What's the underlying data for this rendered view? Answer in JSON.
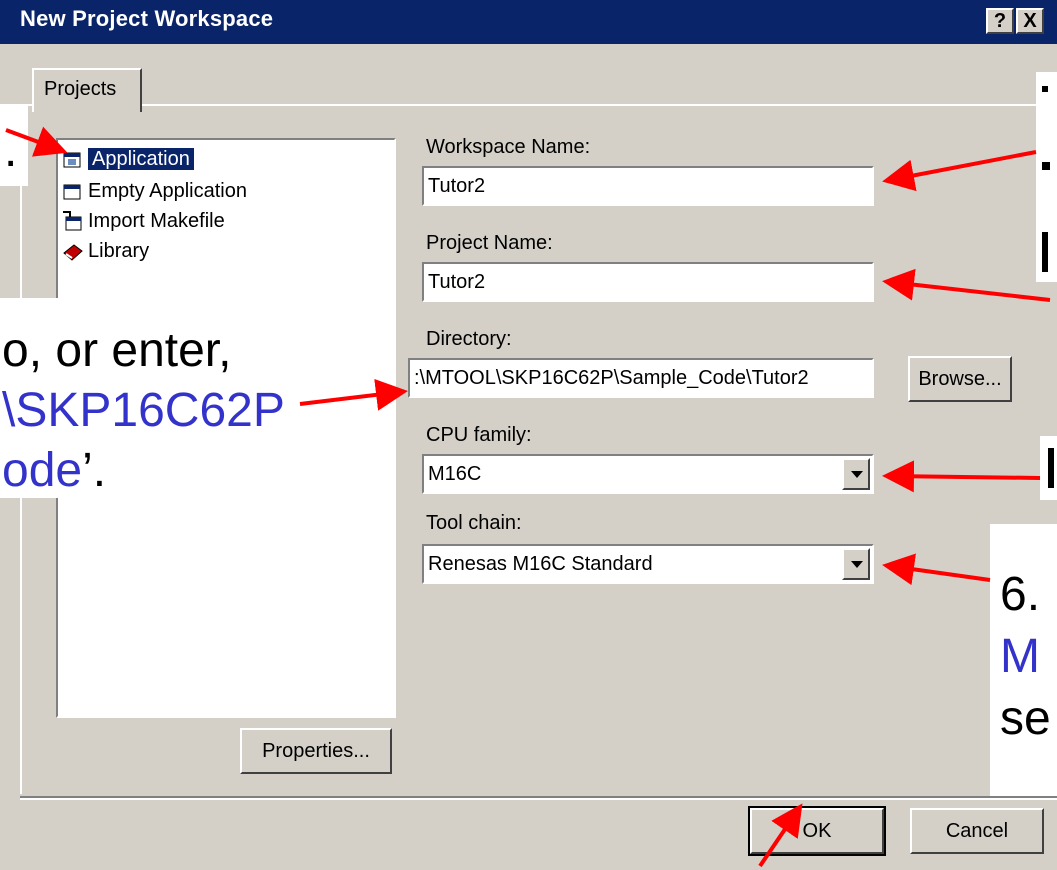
{
  "window": {
    "title": "New Project Workspace",
    "help_button": "?",
    "close_button": "X"
  },
  "tabs": [
    {
      "label": "Projects"
    }
  ],
  "project_types": [
    {
      "label": "Application",
      "icon": "application-icon",
      "selected": true
    },
    {
      "label": "Empty Application",
      "icon": "empty-application-icon",
      "selected": false
    },
    {
      "label": "Import Makefile",
      "icon": "import-makefile-icon",
      "selected": false
    },
    {
      "label": "Library",
      "icon": "library-icon",
      "selected": false
    }
  ],
  "form": {
    "workspace_name": {
      "label": "Workspace Name:",
      "value": "Tutor2"
    },
    "project_name": {
      "label": "Project Name:",
      "value": "Tutor2"
    },
    "directory": {
      "label": "Directory:",
      "value": ":\\MTOOL\\SKP16C62P\\Sample_Code\\Tutor2"
    },
    "cpu_family": {
      "label": "CPU family:",
      "value": "M16C"
    },
    "tool_chain": {
      "label": "Tool chain:",
      "value": "Renesas M16C Standard"
    }
  },
  "buttons": {
    "browse": "Browse...",
    "properties": "Properties...",
    "ok": "OK",
    "cancel": "Cancel"
  },
  "annotations": {
    "left_top_fragment": ".",
    "left_mid_line1": "o, or enter,",
    "left_mid_line2": "\\SKP16C62P",
    "left_mid_line3_blue": "ode",
    "left_mid_line3_rest": "’.",
    "right_top_line1": "",
    "right_top_line2": "",
    "right_top_line3": "",
    "right_mid_text": "",
    "right_bottom_line1": "6.",
    "right_bottom_line2": "M",
    "right_bottom_line3": "se"
  },
  "colors": {
    "titlebar": "#0a246a",
    "dialog_bg": "#d4d0c8",
    "arrow": "#ff0000",
    "annotation_blue": "#3333cc"
  }
}
